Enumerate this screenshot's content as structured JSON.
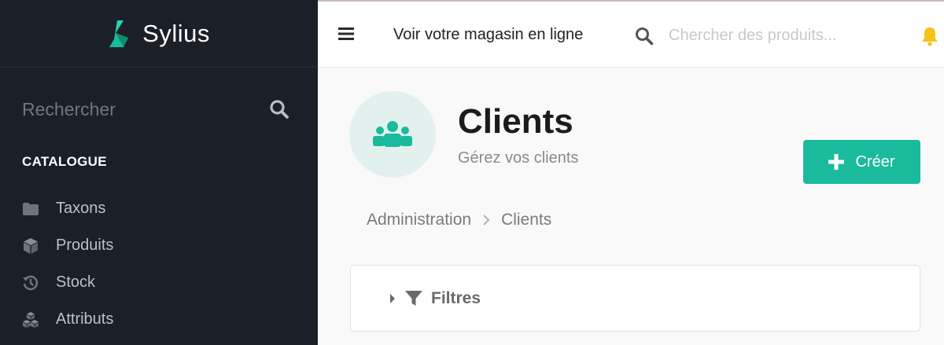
{
  "brand": {
    "name": "Sylius",
    "accent": "#1abb9c"
  },
  "sidebar": {
    "search_placeholder": "Rechercher",
    "section_title": "CATALOGUE",
    "items": [
      {
        "label": "Taxons",
        "icon": "folder-icon"
      },
      {
        "label": "Produits",
        "icon": "cube-icon"
      },
      {
        "label": "Stock",
        "icon": "history-icon"
      },
      {
        "label": "Attributs",
        "icon": "cubes-icon"
      }
    ]
  },
  "topbar": {
    "store_link": "Voir votre magasin en ligne",
    "search_placeholder": "Chercher des produits..."
  },
  "header": {
    "title": "Clients",
    "subtitle": "Gérez vos clients",
    "create_label": "Créer"
  },
  "breadcrumb": [
    "Administration",
    "Clients"
  ],
  "filters": {
    "label": "Filtres"
  }
}
